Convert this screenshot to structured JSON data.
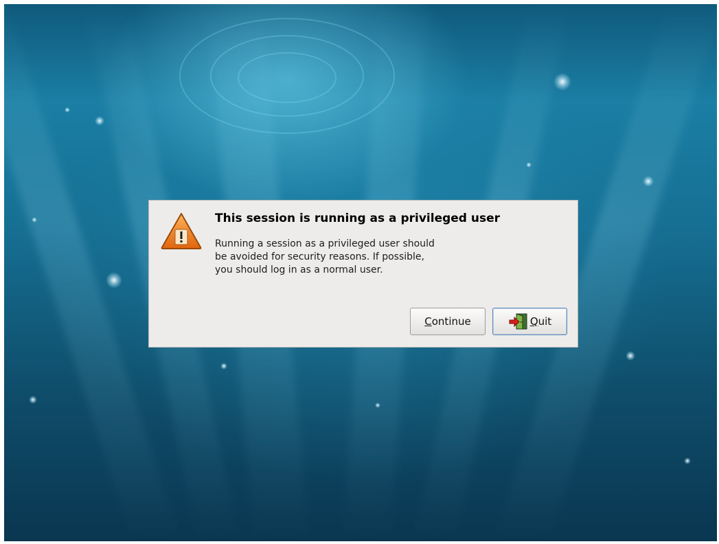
{
  "dialog": {
    "title": "This session is running as a privileged user",
    "message": "Running a session as a privileged user should\nbe avoided for security reasons. If possible,\nyou should log in as a normal user.",
    "icon": "warning-icon",
    "buttons": {
      "continue": {
        "mnemonic": "C",
        "rest": "ontinue"
      },
      "quit": {
        "mnemonic": "Q",
        "rest": "uit",
        "icon": "exit-door-icon"
      }
    }
  },
  "colors": {
    "dialog_background": "#edeceb",
    "warning_orange": "#f07d1a",
    "desktop_accent": "#1b7ea4",
    "default_button_border": "#5b88b8"
  }
}
